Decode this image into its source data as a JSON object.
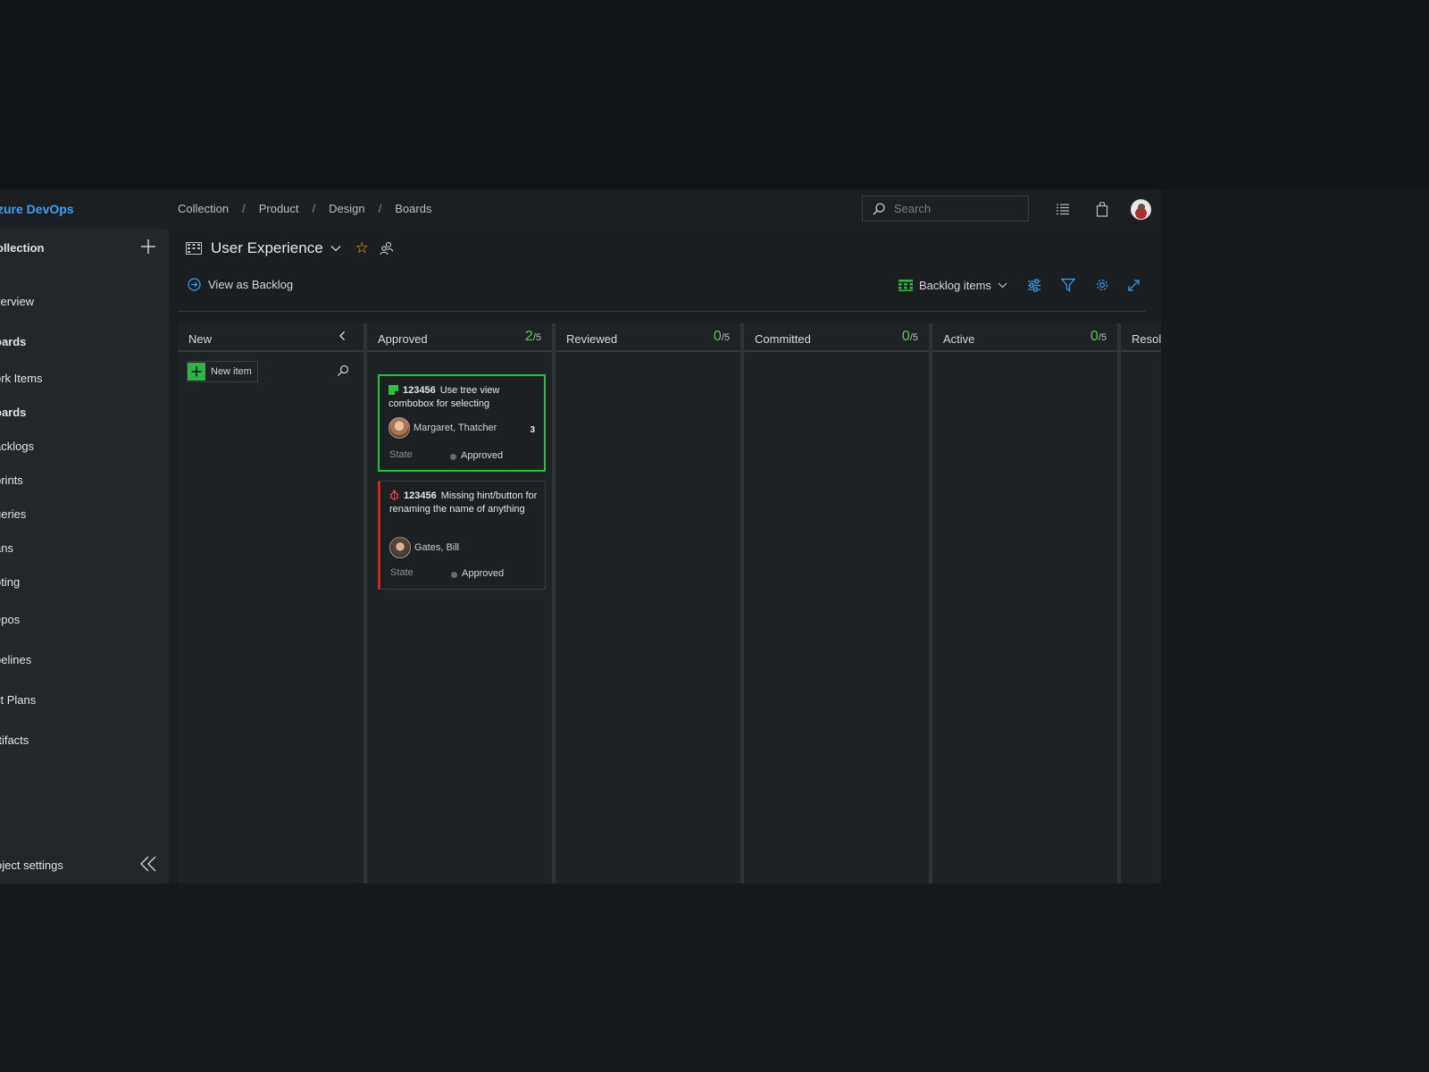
{
  "header": {
    "brand": "zure DevOps",
    "breadcrumbs": [
      "Collection",
      "Product",
      "Design",
      "Boards"
    ],
    "search_placeholder": "Search"
  },
  "sidebar": {
    "collection": "ollection",
    "items": [
      {
        "label": "verview"
      },
      {
        "label": "oards"
      },
      {
        "label": "ork Items"
      },
      {
        "label": "oards"
      },
      {
        "label": "acklogs"
      },
      {
        "label": "prints"
      },
      {
        "label": "ueries"
      },
      {
        "label": "ans"
      },
      {
        "label": "oting"
      },
      {
        "label": "epos"
      },
      {
        "label": "pelines"
      },
      {
        "label": "st Plans"
      },
      {
        "label": "rtifacts"
      }
    ],
    "footer": "oject settings"
  },
  "page": {
    "title": "User Experience",
    "view_as_backlog": "View as Backlog",
    "backlog_level": "Backlog items"
  },
  "board": {
    "new_item_label": "New item",
    "columns": [
      {
        "name": "New",
        "count": "",
        "limit": ""
      },
      {
        "name": "Approved",
        "count": "2",
        "limit": "/5"
      },
      {
        "name": "Reviewed",
        "count": "0",
        "limit": "/5"
      },
      {
        "name": "Committed",
        "count": "0",
        "limit": "/5"
      },
      {
        "name": "Active",
        "count": "0",
        "limit": "/5"
      },
      {
        "name": "Resolv",
        "count": "",
        "limit": ""
      }
    ],
    "cards": [
      {
        "id": "123456",
        "title": "Use tree view combobox for selecting",
        "assignee": "Margaret, Thatcher",
        "badge": "3",
        "state_label": "State",
        "state": "Approved",
        "type_color": "#28c040"
      },
      {
        "id": "123456",
        "title": "Missing hint/button for renaming the name of anything",
        "assignee": "Gates, Bill",
        "badge": "",
        "state_label": "State",
        "state": "Approved",
        "type_color": "#c42b1c"
      }
    ]
  },
  "colors": {
    "accent": "#3aa0f2",
    "success": "#28c040",
    "bug": "#c42b1c",
    "star": "#f0b400"
  }
}
